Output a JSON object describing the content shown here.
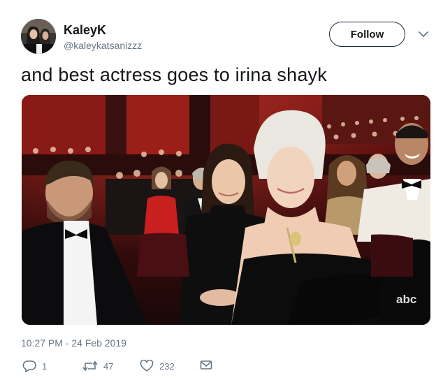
{
  "user": {
    "display_name": "KaleyK",
    "handle": "@kaleykatsanizzz"
  },
  "follow_label": "Follow",
  "tweet": {
    "text": "and best actress goes to irina shayk",
    "timestamp": "10:27 PM - 24 Feb 2019"
  },
  "media": {
    "watermark": "abc"
  },
  "actions": {
    "replies": "1",
    "retweets": "47",
    "likes": "232"
  },
  "icons": {
    "follow_menu": "chevron-down-icon",
    "reply": "reply-icon",
    "retweet": "retweet-icon",
    "like": "heart-icon",
    "message": "envelope-icon"
  },
  "colors": {
    "secondary_text": "#657786",
    "primary_text": "#14171a"
  }
}
